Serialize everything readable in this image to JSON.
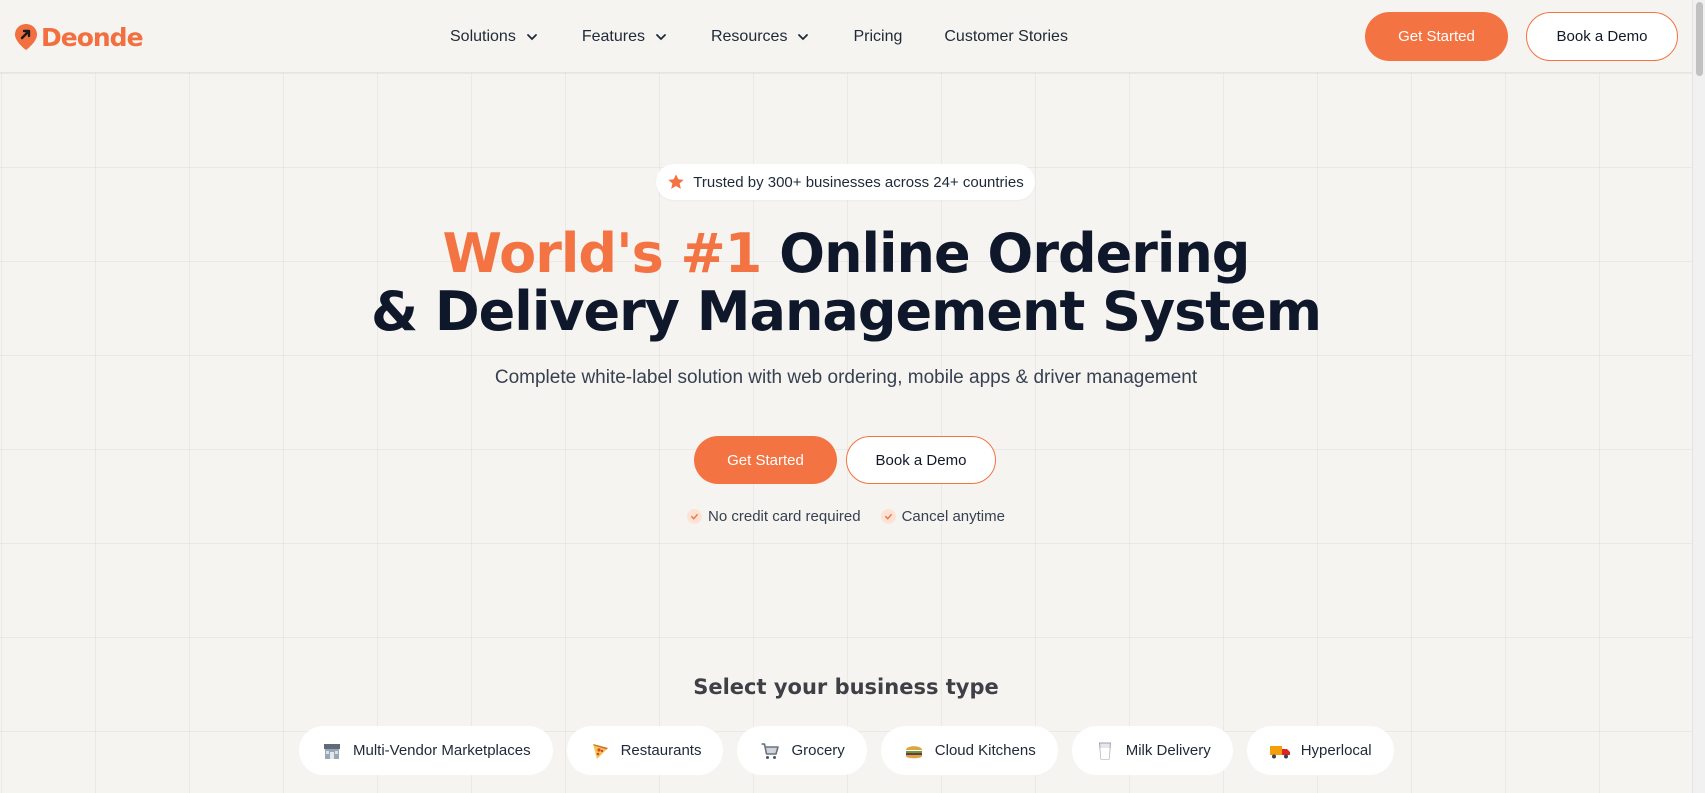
{
  "brand": {
    "name": "Deonde",
    "accent_color": "#f47342",
    "icon": "location-pin-arrow-icon"
  },
  "nav": {
    "items": [
      {
        "label": "Solutions",
        "has_dropdown": true
      },
      {
        "label": "Features",
        "has_dropdown": true
      },
      {
        "label": "Resources",
        "has_dropdown": true
      },
      {
        "label": "Pricing",
        "has_dropdown": false
      },
      {
        "label": "Customer Stories",
        "has_dropdown": false
      }
    ],
    "get_started_label": "Get Started",
    "book_demo_label": "Book a Demo"
  },
  "hero": {
    "badge_text": "Trusted by 300+ businesses across 24+ countries",
    "badge_icon": "star-icon",
    "headline_accent": "World's #1",
    "headline_rest": "Online Ordering",
    "headline_line2": "& Delivery Management System",
    "subtitle": "Complete white-label solution with web ordering, mobile apps & driver management",
    "get_started_label": "Get Started",
    "book_demo_label": "Book a Demo",
    "perks": [
      "No credit card required",
      "Cancel anytime"
    ]
  },
  "business_types": {
    "title": "Select your business type",
    "items": [
      {
        "label": "Multi-Vendor Marketplaces",
        "icon": "storefront-icon"
      },
      {
        "label": "Restaurants",
        "icon": "pizza-icon"
      },
      {
        "label": "Grocery",
        "icon": "shopping-cart-icon"
      },
      {
        "label": "Cloud Kitchens",
        "icon": "burger-icon"
      },
      {
        "label": "Milk Delivery",
        "icon": "milk-glass-icon"
      },
      {
        "label": "Hyperlocal",
        "icon": "delivery-truck-icon"
      }
    ]
  }
}
